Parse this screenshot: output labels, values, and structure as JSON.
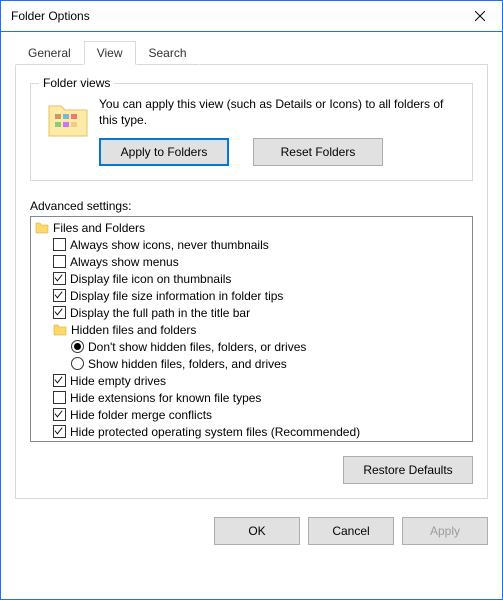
{
  "title": "Folder Options",
  "tabs": [
    "General",
    "View",
    "Search"
  ],
  "active_tab": 1,
  "folder_views": {
    "label": "Folder views",
    "desc": "You can apply this view (such as Details or Icons) to all folders of this type.",
    "apply_btn": "Apply to Folders",
    "reset_btn": "Reset Folders"
  },
  "advanced_label": "Advanced settings:",
  "tree": [
    {
      "type": "folder",
      "indent": 0,
      "label": "Files and Folders"
    },
    {
      "type": "check",
      "indent": 1,
      "checked": false,
      "label": "Always show icons, never thumbnails"
    },
    {
      "type": "check",
      "indent": 1,
      "checked": false,
      "label": "Always show menus"
    },
    {
      "type": "check",
      "indent": 1,
      "checked": true,
      "label": "Display file icon on thumbnails"
    },
    {
      "type": "check",
      "indent": 1,
      "checked": true,
      "label": "Display file size information in folder tips"
    },
    {
      "type": "check",
      "indent": 1,
      "checked": true,
      "label": "Display the full path in the title bar"
    },
    {
      "type": "folder",
      "indent": 1,
      "label": "Hidden files and folders"
    },
    {
      "type": "radio",
      "indent": 2,
      "selected": true,
      "label": "Don't show hidden files, folders, or drives"
    },
    {
      "type": "radio",
      "indent": 2,
      "selected": false,
      "label": "Show hidden files, folders, and drives"
    },
    {
      "type": "check",
      "indent": 1,
      "checked": true,
      "label": "Hide empty drives"
    },
    {
      "type": "check",
      "indent": 1,
      "checked": false,
      "label": "Hide extensions for known file types"
    },
    {
      "type": "check",
      "indent": 1,
      "checked": true,
      "label": "Hide folder merge conflicts"
    },
    {
      "type": "check",
      "indent": 1,
      "checked": true,
      "label": "Hide protected operating system files (Recommended)"
    }
  ],
  "restore_btn": "Restore Defaults",
  "footer": {
    "ok": "OK",
    "cancel": "Cancel",
    "apply": "Apply"
  }
}
